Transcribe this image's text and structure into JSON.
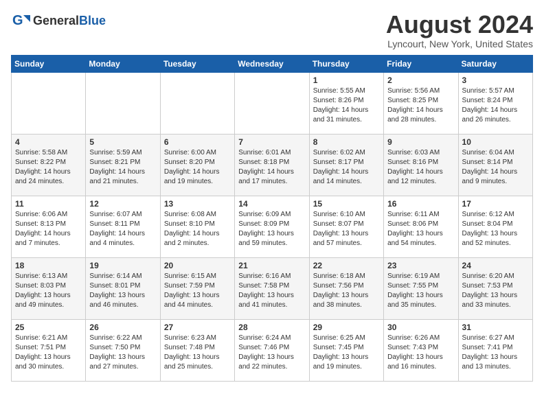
{
  "logo": {
    "general": "General",
    "blue": "Blue"
  },
  "title": "August 2024",
  "location": "Lyncourt, New York, United States",
  "days_header": [
    "Sunday",
    "Monday",
    "Tuesday",
    "Wednesday",
    "Thursday",
    "Friday",
    "Saturday"
  ],
  "weeks": [
    [
      {
        "day": "",
        "content": ""
      },
      {
        "day": "",
        "content": ""
      },
      {
        "day": "",
        "content": ""
      },
      {
        "day": "",
        "content": ""
      },
      {
        "day": "1",
        "content": "Sunrise: 5:55 AM\nSunset: 8:26 PM\nDaylight: 14 hours\nand 31 minutes."
      },
      {
        "day": "2",
        "content": "Sunrise: 5:56 AM\nSunset: 8:25 PM\nDaylight: 14 hours\nand 28 minutes."
      },
      {
        "day": "3",
        "content": "Sunrise: 5:57 AM\nSunset: 8:24 PM\nDaylight: 14 hours\nand 26 minutes."
      }
    ],
    [
      {
        "day": "4",
        "content": "Sunrise: 5:58 AM\nSunset: 8:22 PM\nDaylight: 14 hours\nand 24 minutes."
      },
      {
        "day": "5",
        "content": "Sunrise: 5:59 AM\nSunset: 8:21 PM\nDaylight: 14 hours\nand 21 minutes."
      },
      {
        "day": "6",
        "content": "Sunrise: 6:00 AM\nSunset: 8:20 PM\nDaylight: 14 hours\nand 19 minutes."
      },
      {
        "day": "7",
        "content": "Sunrise: 6:01 AM\nSunset: 8:18 PM\nDaylight: 14 hours\nand 17 minutes."
      },
      {
        "day": "8",
        "content": "Sunrise: 6:02 AM\nSunset: 8:17 PM\nDaylight: 14 hours\nand 14 minutes."
      },
      {
        "day": "9",
        "content": "Sunrise: 6:03 AM\nSunset: 8:16 PM\nDaylight: 14 hours\nand 12 minutes."
      },
      {
        "day": "10",
        "content": "Sunrise: 6:04 AM\nSunset: 8:14 PM\nDaylight: 14 hours\nand 9 minutes."
      }
    ],
    [
      {
        "day": "11",
        "content": "Sunrise: 6:06 AM\nSunset: 8:13 PM\nDaylight: 14 hours\nand 7 minutes."
      },
      {
        "day": "12",
        "content": "Sunrise: 6:07 AM\nSunset: 8:11 PM\nDaylight: 14 hours\nand 4 minutes."
      },
      {
        "day": "13",
        "content": "Sunrise: 6:08 AM\nSunset: 8:10 PM\nDaylight: 14 hours\nand 2 minutes."
      },
      {
        "day": "14",
        "content": "Sunrise: 6:09 AM\nSunset: 8:09 PM\nDaylight: 13 hours\nand 59 minutes."
      },
      {
        "day": "15",
        "content": "Sunrise: 6:10 AM\nSunset: 8:07 PM\nDaylight: 13 hours\nand 57 minutes."
      },
      {
        "day": "16",
        "content": "Sunrise: 6:11 AM\nSunset: 8:06 PM\nDaylight: 13 hours\nand 54 minutes."
      },
      {
        "day": "17",
        "content": "Sunrise: 6:12 AM\nSunset: 8:04 PM\nDaylight: 13 hours\nand 52 minutes."
      }
    ],
    [
      {
        "day": "18",
        "content": "Sunrise: 6:13 AM\nSunset: 8:03 PM\nDaylight: 13 hours\nand 49 minutes."
      },
      {
        "day": "19",
        "content": "Sunrise: 6:14 AM\nSunset: 8:01 PM\nDaylight: 13 hours\nand 46 minutes."
      },
      {
        "day": "20",
        "content": "Sunrise: 6:15 AM\nSunset: 7:59 PM\nDaylight: 13 hours\nand 44 minutes."
      },
      {
        "day": "21",
        "content": "Sunrise: 6:16 AM\nSunset: 7:58 PM\nDaylight: 13 hours\nand 41 minutes."
      },
      {
        "day": "22",
        "content": "Sunrise: 6:18 AM\nSunset: 7:56 PM\nDaylight: 13 hours\nand 38 minutes."
      },
      {
        "day": "23",
        "content": "Sunrise: 6:19 AM\nSunset: 7:55 PM\nDaylight: 13 hours\nand 35 minutes."
      },
      {
        "day": "24",
        "content": "Sunrise: 6:20 AM\nSunset: 7:53 PM\nDaylight: 13 hours\nand 33 minutes."
      }
    ],
    [
      {
        "day": "25",
        "content": "Sunrise: 6:21 AM\nSunset: 7:51 PM\nDaylight: 13 hours\nand 30 minutes."
      },
      {
        "day": "26",
        "content": "Sunrise: 6:22 AM\nSunset: 7:50 PM\nDaylight: 13 hours\nand 27 minutes."
      },
      {
        "day": "27",
        "content": "Sunrise: 6:23 AM\nSunset: 7:48 PM\nDaylight: 13 hours\nand 25 minutes."
      },
      {
        "day": "28",
        "content": "Sunrise: 6:24 AM\nSunset: 7:46 PM\nDaylight: 13 hours\nand 22 minutes."
      },
      {
        "day": "29",
        "content": "Sunrise: 6:25 AM\nSunset: 7:45 PM\nDaylight: 13 hours\nand 19 minutes."
      },
      {
        "day": "30",
        "content": "Sunrise: 6:26 AM\nSunset: 7:43 PM\nDaylight: 13 hours\nand 16 minutes."
      },
      {
        "day": "31",
        "content": "Sunrise: 6:27 AM\nSunset: 7:41 PM\nDaylight: 13 hours\nand 13 minutes."
      }
    ]
  ]
}
